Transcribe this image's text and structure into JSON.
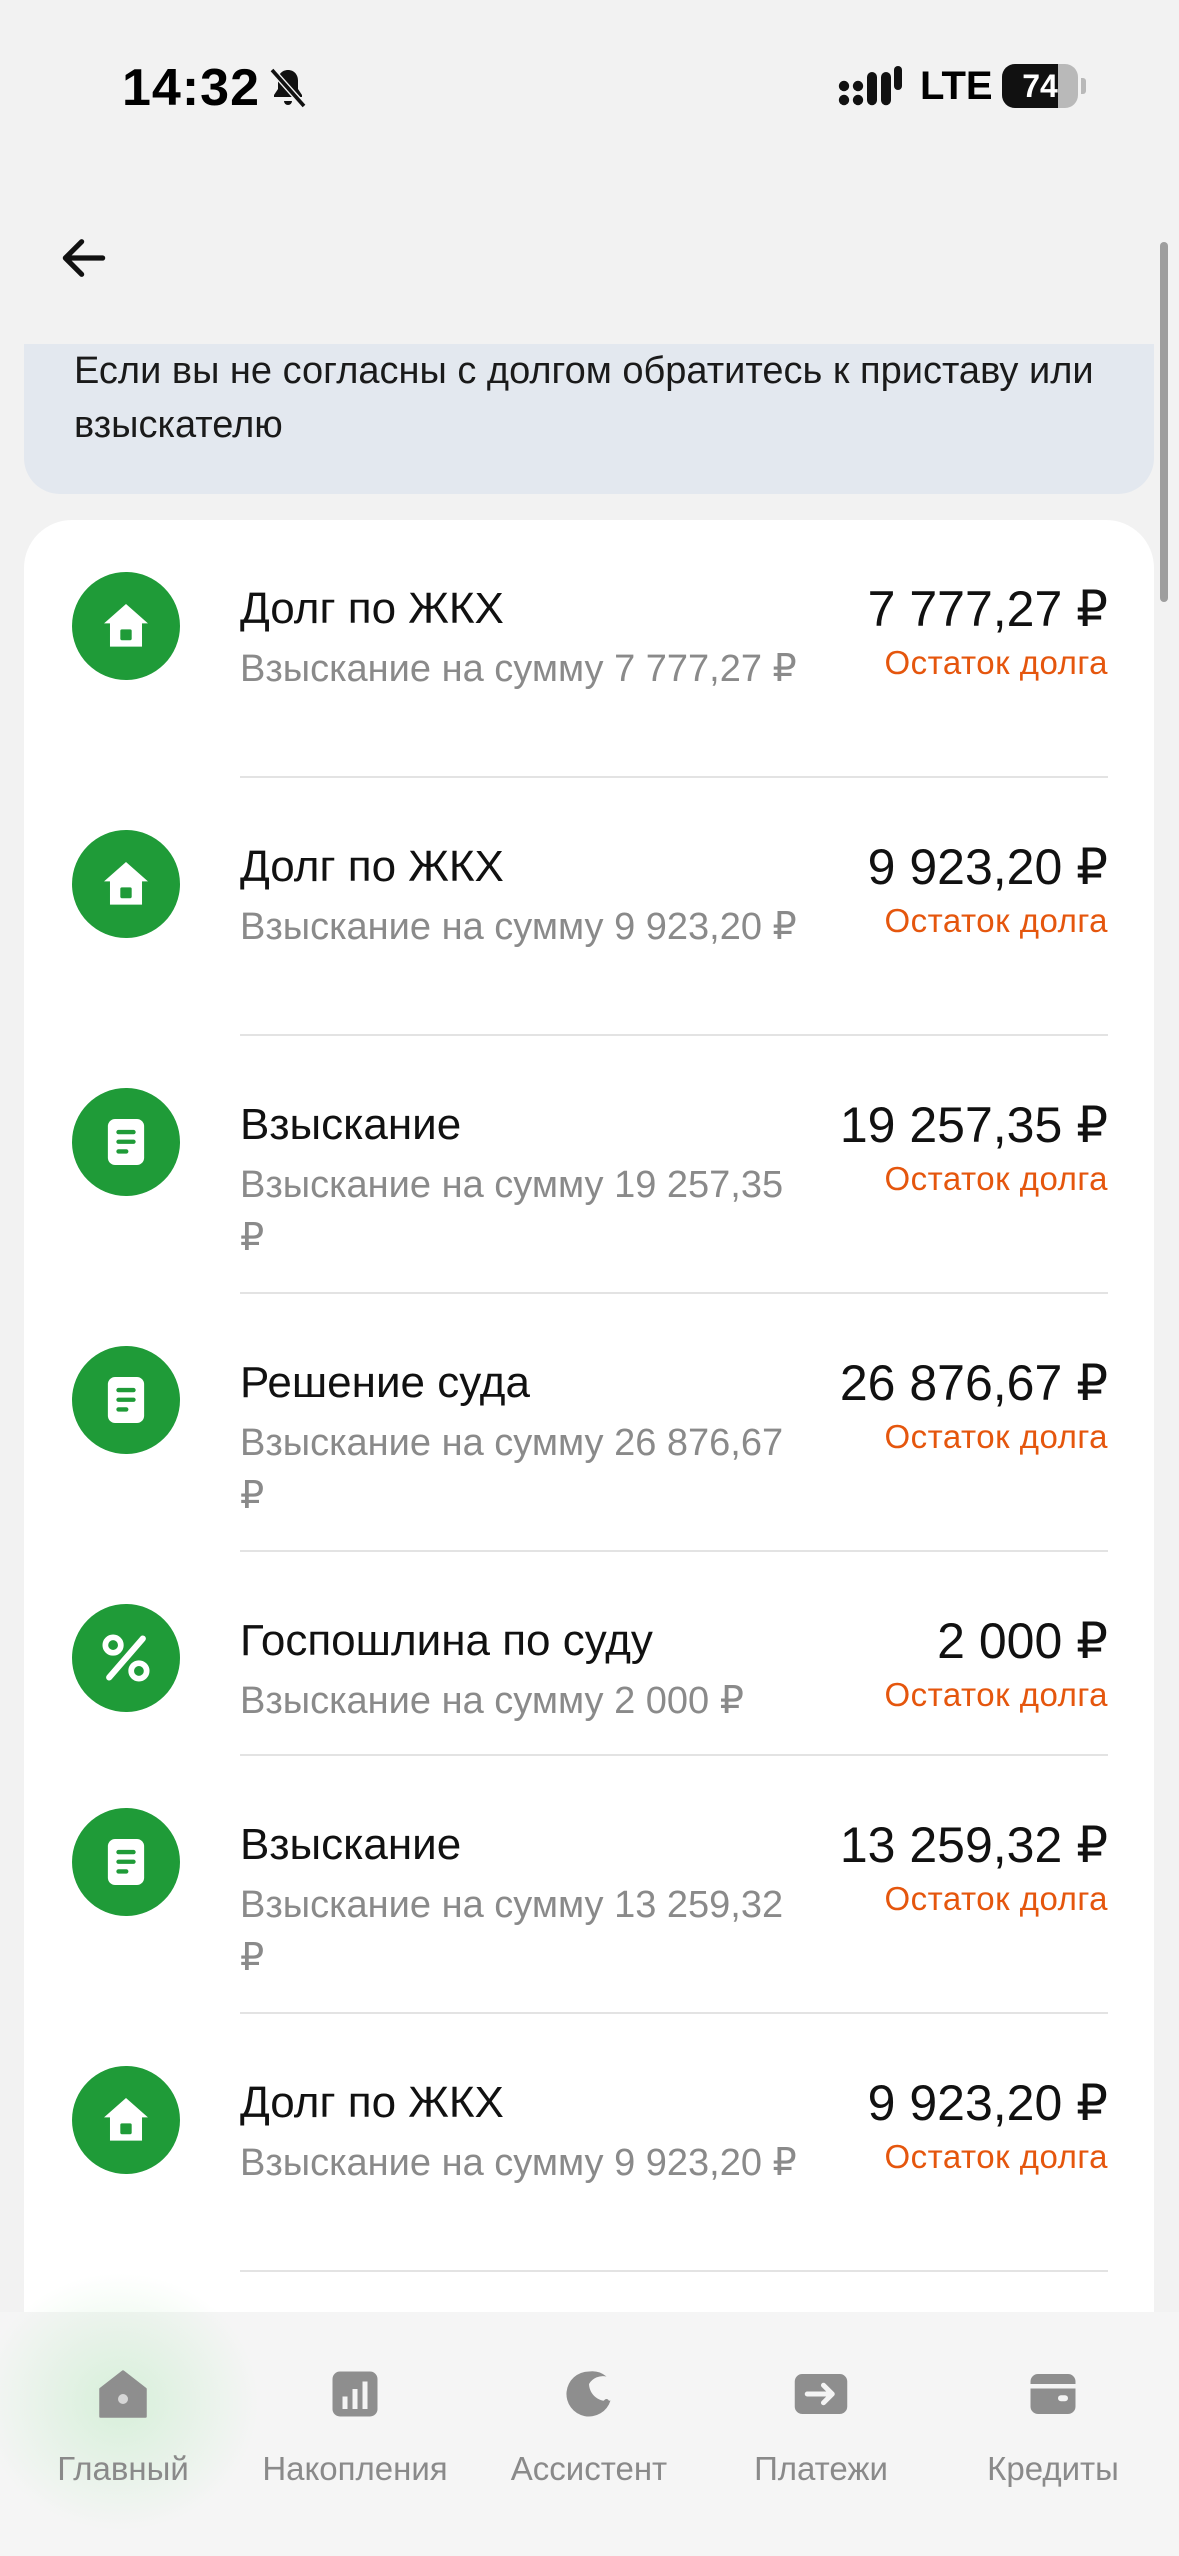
{
  "status_bar": {
    "time": "14:32",
    "network": "LTE",
    "battery_level": "74",
    "battery_fraction": 0.74
  },
  "header": {
    "back_icon": "arrow-left-icon"
  },
  "info_banner": {
    "text": "Если вы не согласны с долгом обратитесь к приставу или взыскателю"
  },
  "colors": {
    "icon_green": "#1f9b38",
    "status_orange": "#e5560d",
    "banner_bg": "#e3e8ef"
  },
  "debts": [
    {
      "icon": "house-icon",
      "title": "Долг по ЖКХ",
      "subtitle": "Взыскание на сумму 7 777,27 ₽",
      "amount": "7 777,27 ₽",
      "status": "Остаток долга"
    },
    {
      "icon": "house-icon",
      "title": "Долг по ЖКХ",
      "subtitle": "Взыскание на сумму 9 923,20 ₽",
      "amount": "9 923,20 ₽",
      "status": "Остаток долга"
    },
    {
      "icon": "document-icon",
      "title": "Взыскание",
      "subtitle": "Взыскание на сумму 19 257,35 ₽",
      "amount": "19 257,35 ₽",
      "status": "Остаток долга"
    },
    {
      "icon": "document-icon",
      "title": "Решение суда",
      "subtitle": "Взыскание на сумму 26 876,67 ₽",
      "amount": "26 876,67 ₽",
      "status": "Остаток долга"
    },
    {
      "icon": "percent-icon",
      "title": "Госпошлина по суду",
      "subtitle": "Взыскание на сумму 2 000 ₽",
      "amount": "2 000 ₽",
      "status": "Остаток долга"
    },
    {
      "icon": "document-icon",
      "title": "Взыскание",
      "subtitle": "Взыскание на сумму 13 259,32 ₽",
      "amount": "13 259,32 ₽",
      "status": "Остаток долга"
    },
    {
      "icon": "house-icon",
      "title": "Долг по ЖКХ",
      "subtitle": "Взыскание на сумму 9 923,20 ₽",
      "amount": "9 923,20 ₽",
      "status": "Остаток долга"
    }
  ],
  "bottom_nav": [
    {
      "icon": "home-icon",
      "label": "Главный"
    },
    {
      "icon": "chart-icon",
      "label": "Накопления"
    },
    {
      "icon": "assistant-icon",
      "label": "Ассистент"
    },
    {
      "icon": "transfer-icon",
      "label": "Платежи"
    },
    {
      "icon": "wallet-icon",
      "label": "Кредиты"
    }
  ]
}
